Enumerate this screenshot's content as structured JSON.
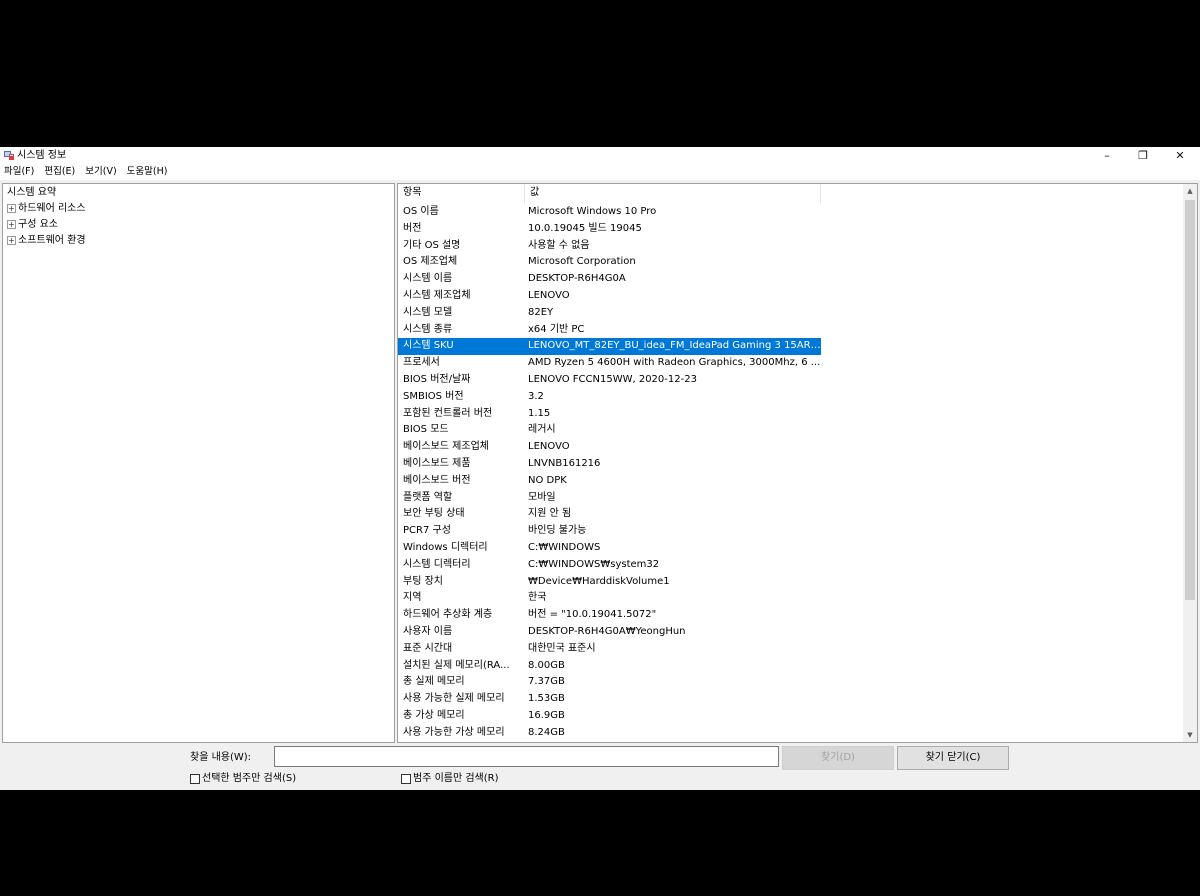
{
  "window": {
    "title": "시스템 정보",
    "controls": {
      "minimize": "–",
      "maximize": "❐",
      "close": "✕"
    }
  },
  "menu": [
    "파일(F)",
    "편집(E)",
    "보기(V)",
    "도움말(H)"
  ],
  "tree": {
    "root": "시스템 요약",
    "children": [
      "하드웨어 리소스",
      "구성 요소",
      "소프트웨어 환경"
    ],
    "expander": "+"
  },
  "list": {
    "headers": {
      "item": "항목",
      "value": "값"
    },
    "selected_index": 9,
    "rows": [
      {
        "item": "OS 이름",
        "value": "Microsoft Windows 10 Pro"
      },
      {
        "item": "버전",
        "value": "10.0.19045 빌드 19045"
      },
      {
        "item": "기타 OS 설명",
        "value": "사용할 수 없음"
      },
      {
        "item": "OS 제조업체",
        "value": "Microsoft Corporation"
      },
      {
        "item": "시스템 이름",
        "value": "DESKTOP-R6H4G0A"
      },
      {
        "item": "시스템 제조업체",
        "value": "LENOVO"
      },
      {
        "item": "시스템 모델",
        "value": "82EY"
      },
      {
        "item": "시스템 종류",
        "value": "x64 기반 PC"
      },
      {
        "item": "시스템 SKU",
        "value": "LENOVO_MT_82EY_BU_idea_FM_IdeaPad Gaming 3 15ARH..."
      },
      {
        "item": "프로세서",
        "value": "AMD Ryzen 5 4600H with Radeon Graphics, 3000Mhz, 6 ..."
      },
      {
        "item": "BIOS 버전/날짜",
        "value": "LENOVO FCCN15WW, 2020-12-23"
      },
      {
        "item": "SMBIOS 버전",
        "value": "3.2"
      },
      {
        "item": "포함된 컨트롤러 버전",
        "value": "1.15"
      },
      {
        "item": "BIOS 모드",
        "value": "레거시"
      },
      {
        "item": "베이스보드 제조업체",
        "value": "LENOVO"
      },
      {
        "item": "베이스보드 제품",
        "value": "LNVNB161216"
      },
      {
        "item": "베이스보드 버전",
        "value": "NO DPK"
      },
      {
        "item": "플랫폼 역할",
        "value": "모바일"
      },
      {
        "item": "보안 부팅 상태",
        "value": "지원 안 됨"
      },
      {
        "item": "PCR7 구성",
        "value": "바인딩 불가능"
      },
      {
        "item": "Windows 디렉터리",
        "value": "C:₩WINDOWS"
      },
      {
        "item": "시스템 디렉터리",
        "value": "C:₩WINDOWS₩system32"
      },
      {
        "item": "부팅 장치",
        "value": "₩Device₩HarddiskVolume1"
      },
      {
        "item": "지역",
        "value": "한국"
      },
      {
        "item": "하드웨어 추상화 계층",
        "value": "버전 = \"10.0.19041.5072\""
      },
      {
        "item": "사용자 이름",
        "value": "DESKTOP-R6H4G0A₩YeongHun"
      },
      {
        "item": "표준 시간대",
        "value": "대한민국 표준시"
      },
      {
        "item": "설치된 실제 메모리(RA...",
        "value": "8.00GB"
      },
      {
        "item": "총 실제 메모리",
        "value": "7.37GB"
      },
      {
        "item": "사용 가능한 실제 메모리",
        "value": "1.53GB"
      },
      {
        "item": "총 가상 메모리",
        "value": "16.9GB"
      },
      {
        "item": "사용 가능한 가상 메모리",
        "value": "8.24GB"
      }
    ]
  },
  "scrollbar": {
    "up": "▲",
    "down": "▼"
  },
  "find": {
    "label": "찾을 내용(W):",
    "value": "",
    "find_button": "찾기(D)",
    "close_button": "찾기 닫기(C)",
    "search_selected_label": "선택한 범주만 검색(S)",
    "search_category_names_label": "범주 이름만 검색(R)"
  }
}
